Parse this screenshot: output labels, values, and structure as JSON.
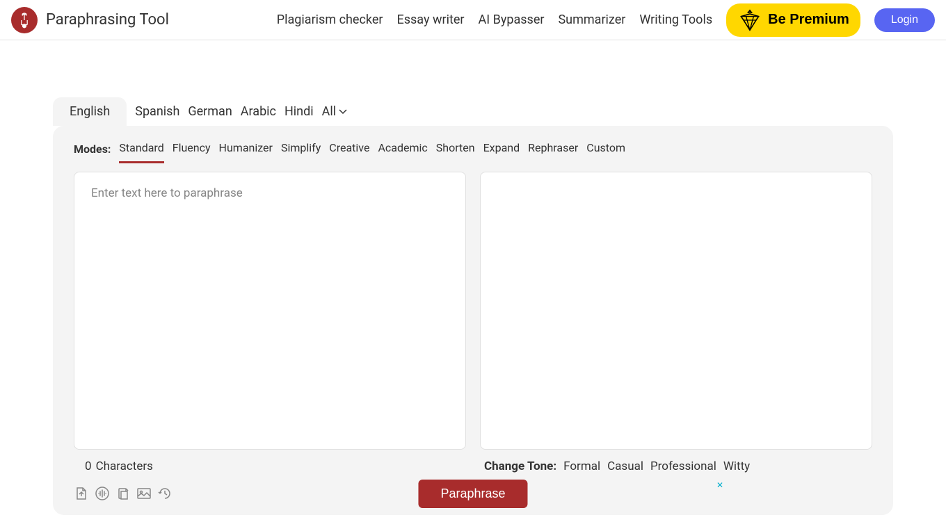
{
  "header": {
    "app_title": "Paraphrasing Tool",
    "nav_links": [
      "Plagiarism checker",
      "Essay writer",
      "AI Bypasser",
      "Summarizer",
      "Writing Tools"
    ],
    "premium_label": "Be Premium",
    "login_label": "Login"
  },
  "languages": {
    "items": [
      "English",
      "Spanish",
      "German",
      "Arabic",
      "Hindi"
    ],
    "all_label": "All",
    "active_index": 0
  },
  "modes": {
    "label": "Modes:",
    "items": [
      "Standard",
      "Fluency",
      "Humanizer",
      "Simplify",
      "Creative",
      "Academic",
      "Shorten",
      "Expand",
      "Rephraser",
      "Custom"
    ],
    "active_index": 0
  },
  "input": {
    "placeholder": "Enter text here to paraphrase",
    "value": ""
  },
  "char_count": {
    "count": "0",
    "label": "Characters"
  },
  "tone": {
    "label": "Change Tone:",
    "items": [
      "Formal",
      "Casual",
      "Professional",
      "Witty"
    ]
  },
  "action": {
    "paraphrase_label": "Paraphrase"
  }
}
